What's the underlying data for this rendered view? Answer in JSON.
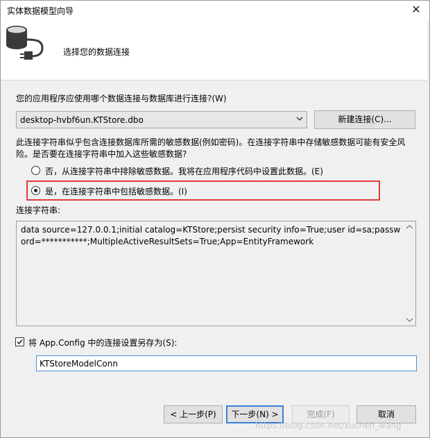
{
  "window": {
    "title": "实体数据模型向导",
    "close_glyph": "✕"
  },
  "header": {
    "title": "选择您的数据连接",
    "icon": "database-plug-icon"
  },
  "question": "您的应用程序应使用哪个数据连接与数据库进行连接?(W)",
  "connection_combo": {
    "selected": "desktop-hvbf6un.KTStore.dbo"
  },
  "new_connection_button": "新建连接(C)...",
  "sensitive_description": "此连接字符串似乎包含连接数据库所需的敏感数据(例如密码)。在连接字符串中存储敏感数据可能有安全风险。是否要在连接字符串中加入这些敏感数据?",
  "radio_options": [
    {
      "label": "否，从连接字符串中排除敏感数据。我将在应用程序代码中设置此数据。(E)",
      "checked": false
    },
    {
      "label": "是，在连接字符串中包括敏感数据。(I)",
      "checked": true
    }
  ],
  "highlight_color": "#e03a3a",
  "connection_string_label": "连接字符串:",
  "connection_string": "data source=127.0.0.1;initial catalog=KTStore;persist security info=True;user id=sa;password=***********;MultipleActiveResultSets=True;App=EntityFramework",
  "save_config": {
    "checked": true,
    "label": "将 App.Config 中的连接设置另存为(S):",
    "value": "KTStoreModelConn"
  },
  "buttons": {
    "prev": "< 上一步(P)",
    "next": "下一步(N) >",
    "finish": "完成(F)",
    "cancel": "取消"
  },
  "watermark": "https://blog.csdn.net/xuchen_wang"
}
